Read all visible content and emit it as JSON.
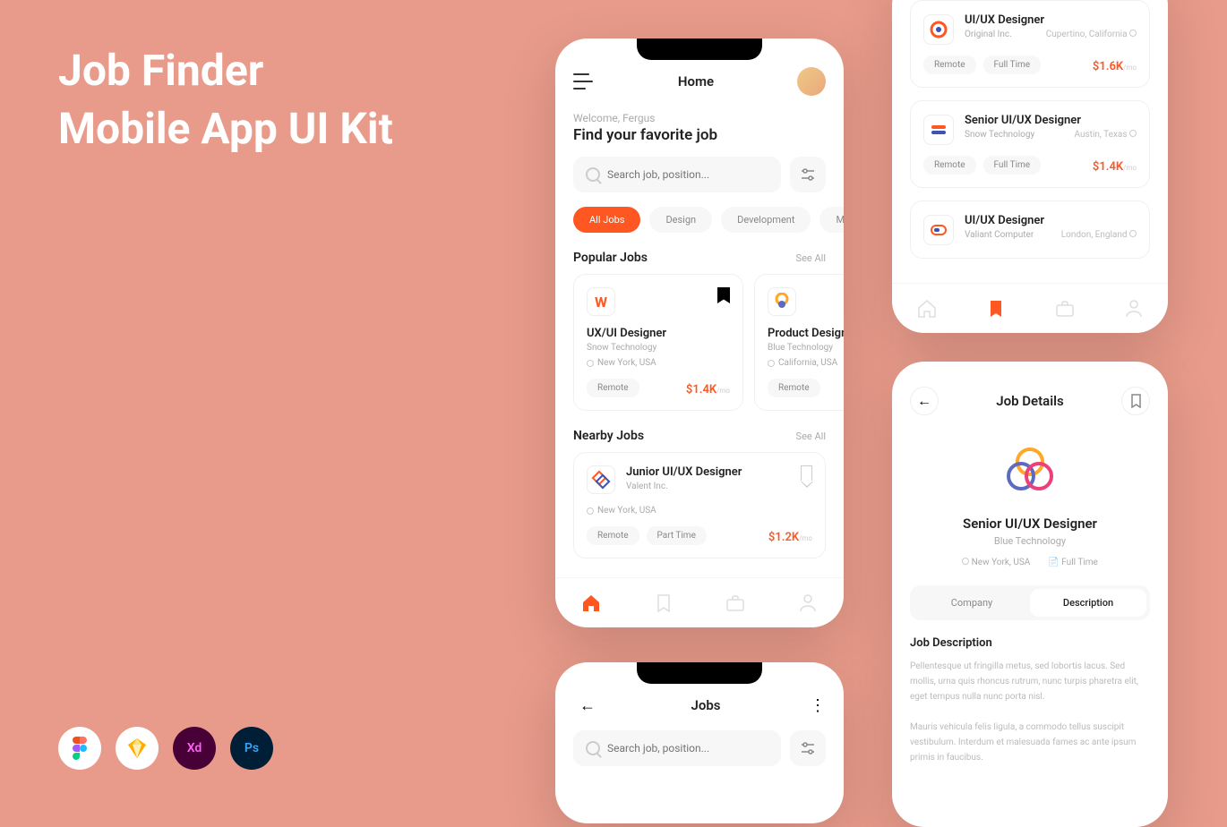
{
  "hero": {
    "line1": "Job Finder",
    "line2": "Mobile App UI Kit"
  },
  "tools": [
    "Figma",
    "Sketch",
    "Xd",
    "Ps"
  ],
  "home": {
    "title": "Home",
    "welcome": "Welcome, Fergus",
    "heading": "Find your favorite job",
    "search_placeholder": "Search job, position...",
    "chips": [
      "All Jobs",
      "Design",
      "Development",
      "Marketing"
    ],
    "popular_title": "Popular Jobs",
    "see_all": "See All",
    "popular": [
      {
        "title": "UX/UI Designer",
        "company": "Snow Technology",
        "location": "New York, USA",
        "tag": "Remote",
        "salary": "$1.4K",
        "per": "/mo"
      },
      {
        "title": "Product Designer",
        "company": "Blue Technology",
        "location": "California, USA",
        "tag": "Remote",
        "salary": "",
        "per": ""
      }
    ],
    "nearby_title": "Nearby Jobs",
    "nearby": {
      "title": "Junior UI/UX Designer",
      "company": "Valent Inc.",
      "location": "New York, USA",
      "tags": [
        "Remote",
        "Part Time"
      ],
      "salary": "$1.2K",
      "per": "/mo"
    }
  },
  "saved": {
    "items": [
      {
        "title": "UI/UX Designer",
        "company": "Original Inc.",
        "location": "Cupertino, California",
        "tags": [
          "Remote",
          "Full Time"
        ],
        "salary": "$1.6K",
        "per": "/mo"
      },
      {
        "title": "Senior UI/UX Designer",
        "company": "Snow Technology",
        "location": "Austin, Texas",
        "tags": [
          "Remote",
          "Full Time"
        ],
        "salary": "$1.4K",
        "per": "/mo"
      },
      {
        "title": "UI/UX Designer",
        "company": "Valiant Computer",
        "location": "London, England",
        "tags": [],
        "salary": "",
        "per": ""
      }
    ]
  },
  "details": {
    "screen_title": "Job Details",
    "title": "Senior UI/UX Designer",
    "company": "Blue Technology",
    "location": "New York, USA",
    "type": "Full Time",
    "tabs": [
      "Company",
      "Description"
    ],
    "desc_head": "Job Description",
    "desc_text": "Pellentesque ut fringilla metus, sed lobortis lacus. Sed mollis, urna quis rhoncus rutrum, nunc turpis pharetra elit, eget tempus nulla nunc porta nisl.\n\nMauris vehicula felis ligula, a commodo tellus suscipit vestibulum. Interdum et malesuada fames ac ante ipsum primis in faucibus."
  },
  "jobs": {
    "title": "Jobs",
    "search_placeholder": "Search job, position..."
  }
}
